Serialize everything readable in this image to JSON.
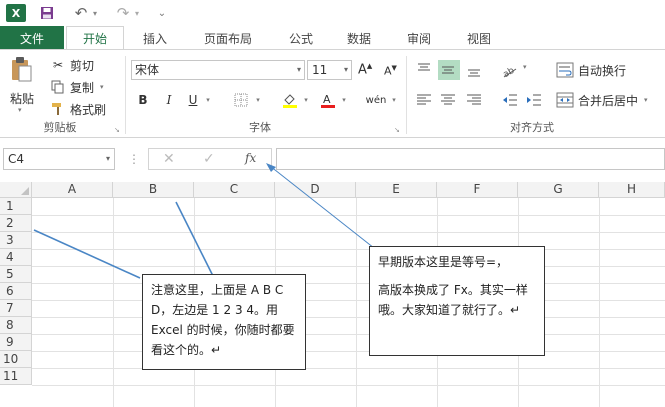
{
  "qat": {
    "logo": "X",
    "save_icon": "save-icon",
    "undo_icon": "undo-icon",
    "redo_icon": "redo-icon",
    "customize_icon": "customize-icon"
  },
  "tabs": {
    "file": "文件",
    "items": [
      "开始",
      "插入",
      "页面布局",
      "公式",
      "数据",
      "审阅",
      "视图"
    ],
    "active": "开始"
  },
  "ribbon": {
    "clipboard": {
      "paste": "粘贴",
      "cut": "剪切",
      "copy": "复制",
      "format_painter": "格式刷",
      "label": "剪贴板"
    },
    "font": {
      "name": "宋体",
      "size": "11",
      "grow": "A",
      "shrink": "A",
      "bold": "B",
      "italic": "I",
      "underline": "U",
      "phonetic": "wén",
      "label": "字体"
    },
    "alignment": {
      "wrap_text": "自动换行",
      "merge_center": "合并后居中",
      "label": "对齐方式"
    }
  },
  "formula_bar": {
    "name_box": "C4",
    "fx": "fx",
    "formula": ""
  },
  "grid": {
    "columns": [
      "A",
      "B",
      "C",
      "D",
      "E",
      "F",
      "G",
      "H"
    ],
    "rows": [
      "1",
      "2",
      "3",
      "4",
      "5",
      "6",
      "7",
      "8",
      "9",
      "10",
      "11"
    ]
  },
  "annotations": {
    "left_note": "注意这里，上面是 A B C D，左边是 1 2 3 4。用 Excel 的时候，你随时都要看这个的。↵",
    "right_note_line1": "早期版本这里是等号=，",
    "right_note_line2": "高版本换成了 Fx。其实一样哦。大家知道了就行了。↵"
  },
  "colors": {
    "accent": "#217346",
    "annotation_line": "#4a86c5"
  }
}
